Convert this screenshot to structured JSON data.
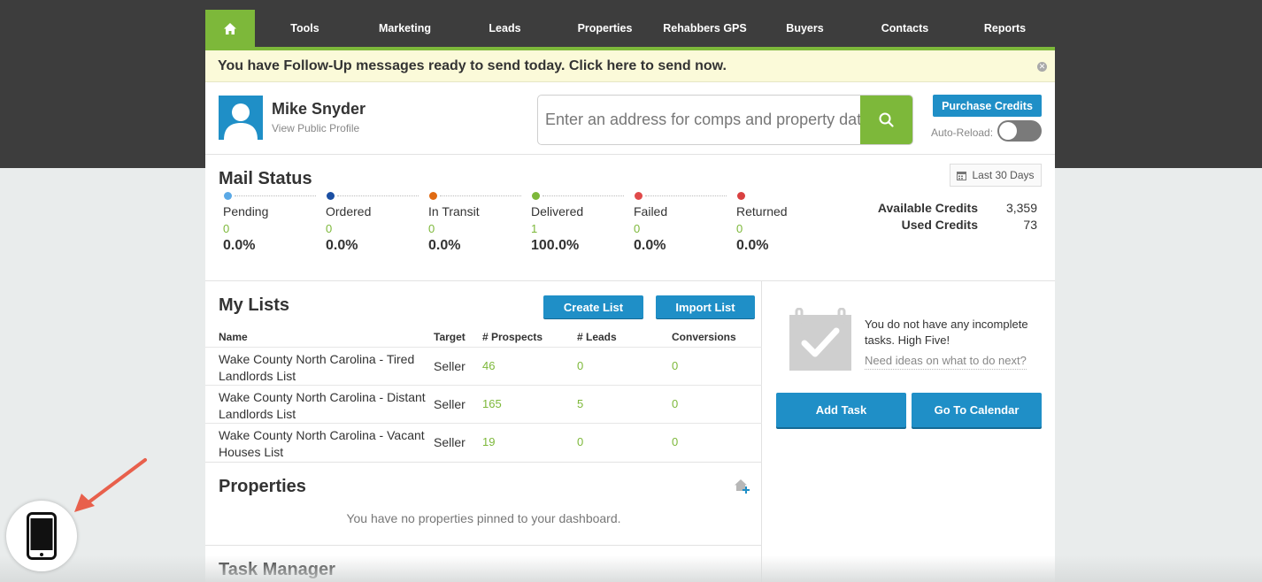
{
  "nav": {
    "items": [
      "Tools",
      "Marketing",
      "Leads",
      "Properties",
      "Rehabbers GPS",
      "Buyers",
      "Contacts",
      "Reports"
    ]
  },
  "banner": {
    "text": "You have Follow-Up messages ready to send today. Click here to send now."
  },
  "profile": {
    "name": "Mike Snyder",
    "link": "View Public Profile"
  },
  "search": {
    "placeholder": "Enter an address for comps and property data"
  },
  "credits_controls": {
    "purchase": "Purchase Credits",
    "auto_reload": "Auto-Reload:"
  },
  "mail_status": {
    "title": "Mail Status",
    "range": "Last 30 Days",
    "stats": [
      {
        "label": "Pending",
        "count": "0",
        "pct": "0.0%",
        "color": "#5aa9e6"
      },
      {
        "label": "Ordered",
        "count": "0",
        "pct": "0.0%",
        "color": "#1b4fa3"
      },
      {
        "label": "In Transit",
        "count": "0",
        "pct": "0.0%",
        "color": "#e06a12"
      },
      {
        "label": "Delivered",
        "count": "1",
        "pct": "100.0%",
        "color": "#7db83a"
      },
      {
        "label": "Failed",
        "count": "0",
        "pct": "0.0%",
        "color": "#e04a4a"
      },
      {
        "label": "Returned",
        "count": "0",
        "pct": "0.0%",
        "color": "#d94040"
      }
    ],
    "available_label": "Available Credits",
    "available_value": "3,359",
    "used_label": "Used Credits",
    "used_value": "73"
  },
  "lists": {
    "title": "My Lists",
    "create": "Create List",
    "import": "Import List",
    "headers": {
      "name": "Name",
      "target": "Target",
      "prospects": "# Prospects",
      "leads": "# Leads",
      "conversions": "Conversions"
    },
    "rows": [
      {
        "name": "Wake County North Carolina - Tired Landlords List",
        "target": "Seller",
        "prospects": "46",
        "leads": "0",
        "conversions": "0"
      },
      {
        "name": "Wake County North Carolina - Distant Landlords List",
        "target": "Seller",
        "prospects": "165",
        "leads": "5",
        "conversions": "0"
      },
      {
        "name": "Wake County North Carolina - Vacant Houses List",
        "target": "Seller",
        "prospects": "19",
        "leads": "0",
        "conversions": "0"
      }
    ]
  },
  "properties": {
    "title": "Properties",
    "empty": "You have no properties pinned to your dashboard."
  },
  "task_manager": {
    "title": "Task Manager"
  },
  "tasks": {
    "message": "You do not have any incomplete tasks. High Five!",
    "ideas": "Need ideas on what to do next?",
    "add": "Add Task",
    "calendar": "Go To Calendar"
  },
  "colors": {
    "green": "#7db83a",
    "blue": "#1f8fc7",
    "dark": "#3d3d3d"
  }
}
